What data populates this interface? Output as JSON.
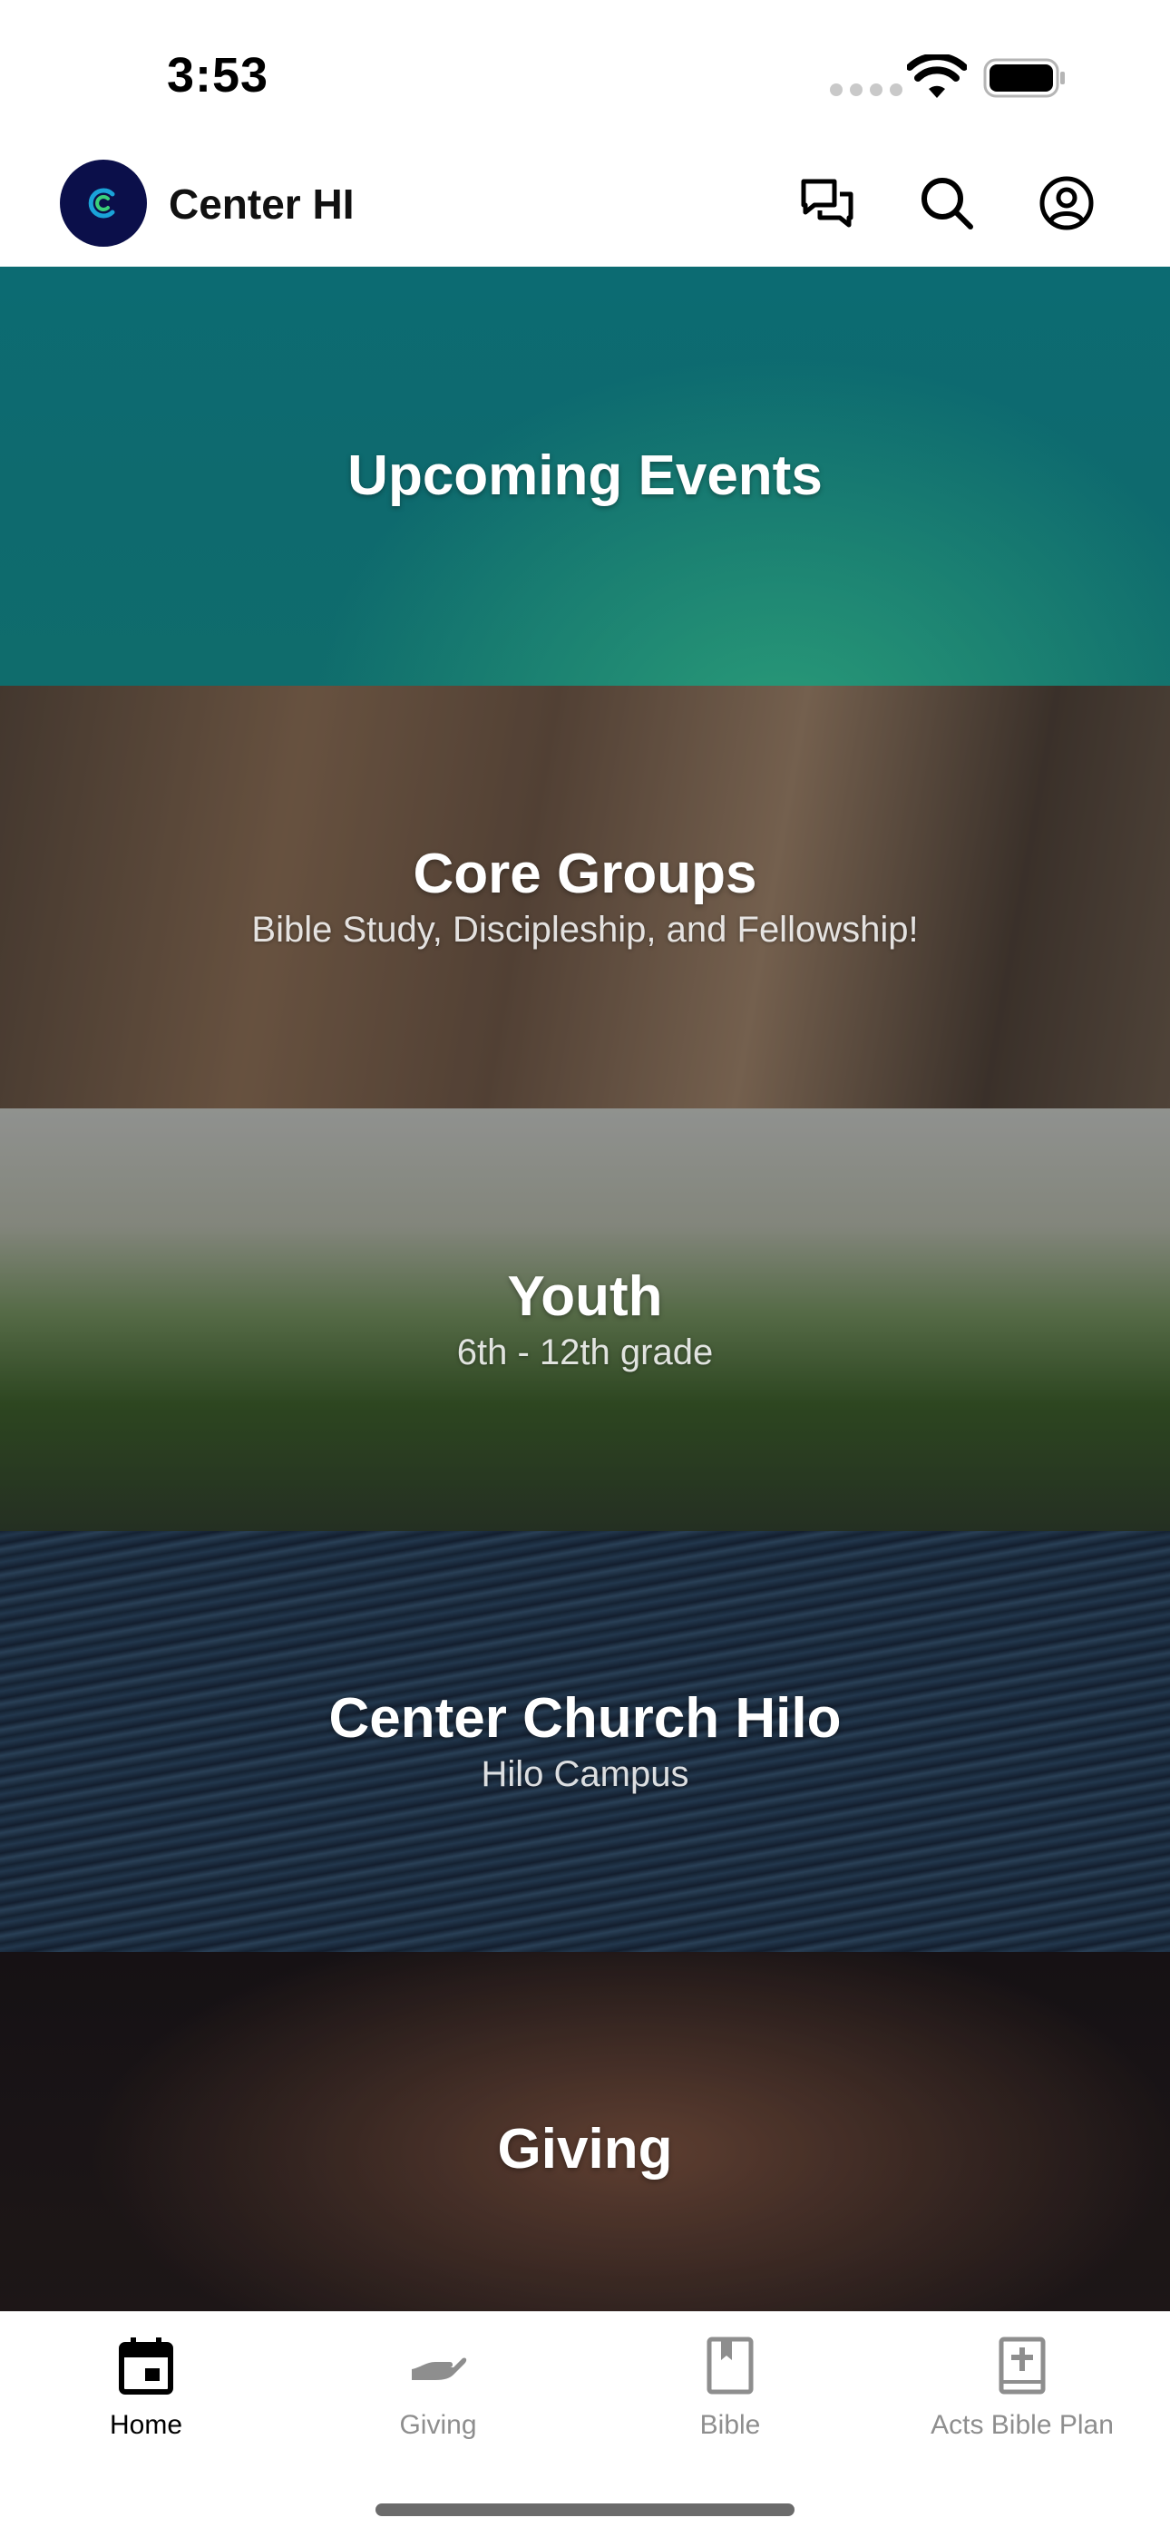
{
  "status_bar": {
    "time": "3:53"
  },
  "header": {
    "app_title": "Center HI",
    "logo_letter": "C"
  },
  "tiles": [
    {
      "title": "Upcoming Events",
      "subtitle": ""
    },
    {
      "title": "Core Groups",
      "subtitle": "Bible Study, Discipleship, and Fellowship!"
    },
    {
      "title": "Youth",
      "subtitle": "6th - 12th grade"
    },
    {
      "title": "Center Church Hilo",
      "subtitle": "Hilo Campus"
    },
    {
      "title": "Giving",
      "subtitle": ""
    }
  ],
  "tab_bar": {
    "items": [
      {
        "label": "Home",
        "icon": "calendar-icon",
        "active": true
      },
      {
        "label": "Giving",
        "icon": "giving-hand-icon",
        "active": false
      },
      {
        "label": "Bible",
        "icon": "bible-book-icon",
        "active": false
      },
      {
        "label": "Acts Bible Plan",
        "icon": "bible-plan-icon",
        "active": false
      }
    ]
  },
  "colors": {
    "brand": "#0b0f4a",
    "accent": "#1aa3d8",
    "inactive_tab": "#8e8e8e"
  }
}
